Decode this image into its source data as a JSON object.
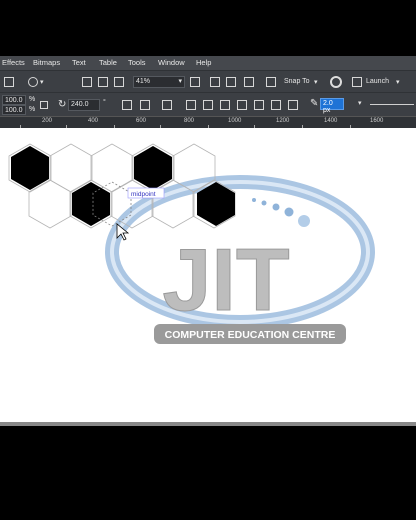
{
  "menu": [
    "Effects",
    "Bitmaps",
    "Text",
    "Table",
    "Tools",
    "Window",
    "Help"
  ],
  "toolbar": {
    "zoom": "41%",
    "snap_label": "Snap To",
    "launch_label": "Launch"
  },
  "property_bar": {
    "scale_x": "100.0",
    "scale_y": "100.0",
    "percent": "%",
    "angle": "240.0",
    "degree": "°",
    "outline_width": "2.0 px"
  },
  "ruler": [
    "200",
    "400",
    "600",
    "800",
    "1000",
    "1200",
    "1400",
    "1600"
  ],
  "canvas": {
    "tooltip": "midpoint",
    "logo_title": "JIT",
    "logo_subtitle": "COMPUTER EDUCATION CENTRE"
  },
  "colors": {
    "app_bg": "#3a3d42",
    "canvas_bg": "#ffffff",
    "accent": "#1e73d6",
    "logo_blue": "#8fb3d9"
  }
}
